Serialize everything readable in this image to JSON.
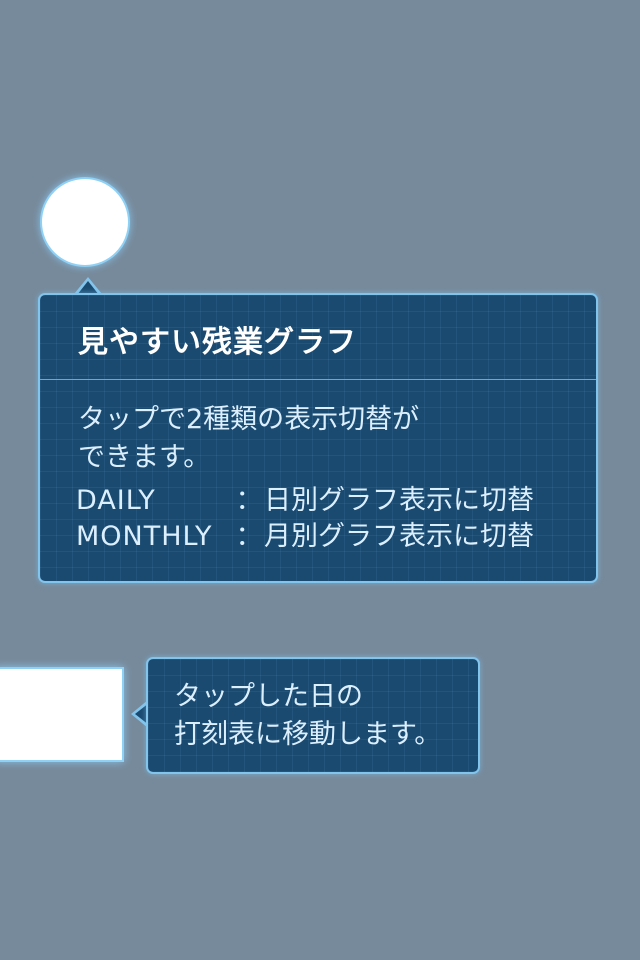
{
  "colors": {
    "background": "#778a9b",
    "bubble_fill": "#1a4a70",
    "bubble_border": "#83c4ec",
    "spotlight": "#ffffff"
  },
  "tip_graph": {
    "title": "見やすい残業グラフ",
    "body_lines": [
      "タップで2種類の表示切替が",
      "できます。"
    ],
    "modes": [
      {
        "key": "DAILY",
        "separator": "：",
        "description": "日別グラフ表示に切替"
      },
      {
        "key": "MONTHLY",
        "separator": "：",
        "description": "月別グラフ表示に切替"
      }
    ]
  },
  "tip_day": {
    "body_lines": [
      "タップした日の",
      "打刻表に移動します。"
    ]
  }
}
